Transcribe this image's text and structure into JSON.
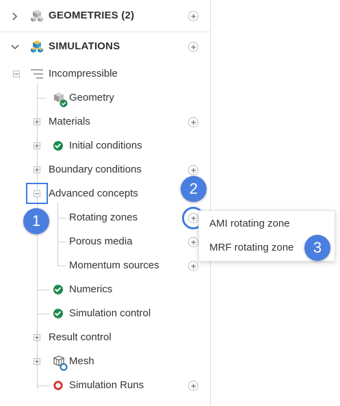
{
  "tree": {
    "geometries": {
      "label": "GEOMETRIES (2)",
      "icon": "geometry-cubes-icon"
    },
    "simulations": {
      "label": "SIMULATIONS",
      "icon": "simulation-cubes-icon"
    },
    "incompressible": {
      "label": "Incompressible",
      "icon": "analysis-type-icon"
    },
    "items": [
      {
        "label": "Geometry",
        "icon": "geometry-check-icon"
      },
      {
        "label": "Materials"
      },
      {
        "label": "Initial conditions",
        "icon": "check-icon"
      },
      {
        "label": "Boundary conditions"
      },
      {
        "label": "Advanced concepts"
      },
      {
        "label": "Rotating zones"
      },
      {
        "label": "Porous media"
      },
      {
        "label": "Momentum sources"
      },
      {
        "label": "Numerics",
        "icon": "check-icon"
      },
      {
        "label": "Simulation control",
        "icon": "check-icon"
      },
      {
        "label": "Result control"
      },
      {
        "label": "Mesh",
        "icon": "mesh-icon"
      },
      {
        "label": "Simulation Runs",
        "icon": "run-status-icon"
      }
    ]
  },
  "popup": {
    "items": [
      "AMI rotating zone",
      "MRF rotating zone"
    ]
  },
  "annotations": [
    "1",
    "2",
    "3"
  ],
  "colors": {
    "accent": "#3d7bdf",
    "check_green": "#1f8a4c",
    "run_red": "#d9352f",
    "badge": "#4a7fe0"
  }
}
